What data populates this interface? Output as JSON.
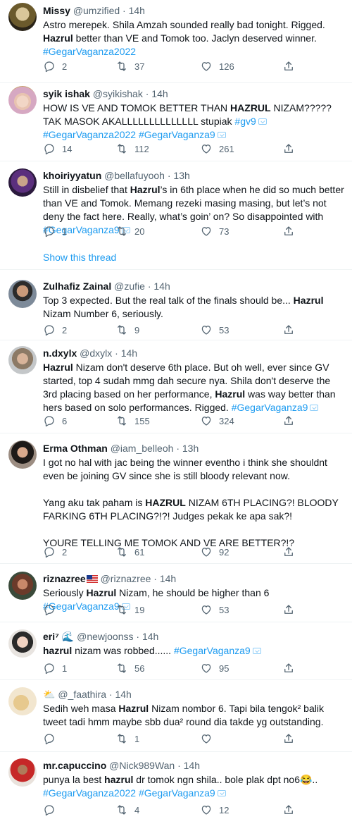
{
  "tweets": [
    {
      "name": "Missy",
      "handle": "@umzified",
      "time": "14h",
      "body_html": "Astro merepek. Shila Amzah sounded really bad tonight. Rigged. <b>Hazrul</b> better than VE and Tomok too. Jaclyn deserved winner. <span class=\"tag\">#GegarVaganza2022</span>",
      "replies": "2",
      "retweets": "37",
      "likes": "126"
    },
    {
      "name": "syik ishak",
      "handle": "@syikishak",
      "time": "14h",
      "body_html": "HOW IS VE AND TOMOK BETTER THAN <b>HAZRUL</b> NIZAM????? TAK MASOK AKALLLLLLLLLLLLLL stupiak <span class=\"tag\">#gv9</span><i class=\"vbadge\"></i> <span class=\"tag\">#GegarVaganza2022</span> <span class=\"tag\">#GegarVaganza9</span><i class=\"vbadge\"></i>",
      "replies": "14",
      "retweets": "112",
      "likes": "261"
    },
    {
      "name": "khoiriyyatun",
      "handle": "@bellafuyooh",
      "time": "13h",
      "body_html": "Still in disbelief that <b>Hazrul</b>’s in 6th place when he did so much better than VE and Tomok. Memang rezeki masing masing, but let’s not deny the fact here. Really, what’s goin’ on? So disappointed with <span class=\"tag\">#GegarVaganza9</span><i class=\"vbadge\"></i>",
      "replies": "1",
      "retweets": "20",
      "likes": "73"
    },
    {
      "name": "Zulhafiz Zainal",
      "handle": "@zufie",
      "time": "14h",
      "body_html": "Top 3 expected. But the real talk of the finals should be... <b>Hazrul</b> Nizam Number 6, seriously.",
      "replies": "2",
      "retweets": "9",
      "likes": "53"
    },
    {
      "name": "n.dxylx",
      "handle": "@dxylx",
      "time": "14h",
      "body_html": "<b>Hazrul</b> Nizam don't deserve 6th place. But oh well, ever since GV started, top 4 sudah mmg dah secure nya. Shila don't deserve the 3rd placing based on her performance, <b>Hazrul</b> was way better than hers based on solo performances. Rigged. <span class=\"tag\">#GegarVaganza9</span><i class=\"vbadge\"></i>",
      "replies": "6",
      "retweets": "155",
      "likes": "324"
    },
    {
      "name": "Erma Othman",
      "handle": "@iam_belleoh",
      "time": "13h",
      "body_html": "<span class=\"para\">I got no hal with jac being the winner eventho i think she shouldnt even be joining GV since she is still bloody relevant now.</span><span class=\"gap\"></span><span class=\"para\">Yang aku tak paham is <b>HAZRUL</b> NIZAM 6TH PLACING?! BLOODY FARKING 6TH PLACING?!?! Judges pekak ke apa sak?!</span><span class=\"gap\"></span><span class=\"para\">YOURE TELLING ME TOMOK AND VE ARE BETTER?!?</span>",
      "replies": "2",
      "retweets": "61",
      "likes": "92"
    },
    {
      "name": "riznazree",
      "handle": "@riznazree",
      "time": "14h",
      "body_html": "Seriously <b>Hazrul</b> Nizam, he should be higher than 6 <span class=\"tag\">#GegarVaganza9</span><i class=\"vbadge\"></i>",
      "replies": "",
      "retweets": "19",
      "likes": "53"
    },
    {
      "name": "eri⁷",
      "handle": "@newjoonss",
      "time": "14h",
      "body_html": "<b>hazrul</b> nizam was robbed...... <span class=\"tag\">#GegarVaganza9</span><i class=\"vbadge\"></i>",
      "replies": "1",
      "retweets": "56",
      "likes": "95"
    },
    {
      "name": "",
      "handle": "@_faathira",
      "time": "14h",
      "body_html": "Sedih weh masa <b>Hazrul</b> Nizam nombor 6. Tapi bila tengok² balik tweet tadi hmm maybe sbb dua² round dia takde yg outstanding.",
      "replies": "",
      "retweets": "1",
      "likes": ""
    },
    {
      "name": "mr.capuccino",
      "handle": "@Nick989Wan",
      "time": "14h",
      "body_html": "punya la best <b>hazrul</b> dr tomok ngn shila.. bole plak dpt no6😂.. <span class=\"tag\">#GegarVaganza2022</span> <span class=\"tag\">#GegarVaganza9</span><i class=\"vbadge\"></i>",
      "replies": "",
      "retweets": "4",
      "likes": "12"
    }
  ],
  "show_thread_label": "Show this thread",
  "dot": "·"
}
